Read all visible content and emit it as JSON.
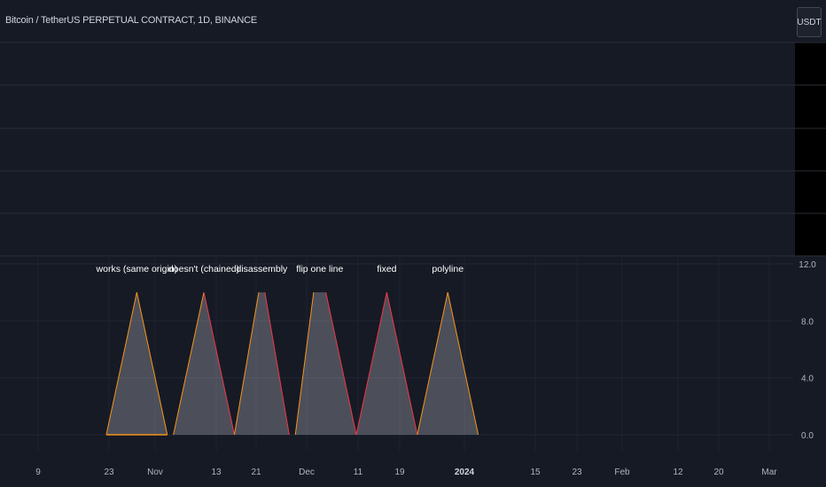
{
  "header": {
    "symbol_title": "Bitcoin / TetherUS PERPETUAL CONTRACT, 1D, BINANCE",
    "currency_button": "USDT"
  },
  "colors": {
    "background": "#161a25",
    "price_axis_background": "#000000",
    "grid": "#2a2e39",
    "line_orange": "#f7931a",
    "line_red": "#f23645",
    "fill": "rgba(178,181,190,0.35)"
  },
  "chart_data": {
    "type": "area",
    "title": "",
    "xlabel": "",
    "ylabel": "",
    "ylim": [
      0,
      12
    ],
    "y_ticks": [
      "12.0",
      "8.0",
      "4.0",
      "0.0"
    ],
    "x_ticks": [
      "9",
      "23",
      "Nov",
      "13",
      "21",
      "Dec",
      "11",
      "19",
      "2024",
      "15",
      "23",
      "Feb",
      "12",
      "20",
      "Mar"
    ],
    "grid": true,
    "shapes": [
      {
        "label": "works (same origin)",
        "points": [
          {
            "x": "2023-10-24",
            "y": 0
          },
          {
            "x": "2023-10-29",
            "y": 10
          },
          {
            "x": "2023-11-03",
            "y": 0
          }
        ],
        "base_line": "orange",
        "edges": [
          "orange",
          "orange"
        ]
      },
      {
        "label": "doesn't (chained)",
        "points": [
          {
            "x": "2023-11-04",
            "y": 0
          },
          {
            "x": "2023-11-09",
            "y": 10
          },
          {
            "x": "2023-11-14",
            "y": 0
          }
        ],
        "edges": [
          "orange",
          "red"
        ]
      },
      {
        "label": "disassembly",
        "points": [
          {
            "x": "2023-11-14",
            "y": 0
          },
          {
            "x": "2023-11-18",
            "y": 10
          },
          {
            "x": "2023-11-19",
            "y": 10
          },
          {
            "x": "2023-11-23",
            "y": 0
          }
        ],
        "edges": [
          "orange",
          "red"
        ]
      },
      {
        "label": "flip one line",
        "points": [
          {
            "x": "2023-11-24",
            "y": 0
          },
          {
            "x": "2023-11-27",
            "y": 10
          },
          {
            "x": "2023-11-29",
            "y": 10
          },
          {
            "x": "2023-12-04",
            "y": 0
          }
        ],
        "edges": [
          "orange",
          "red"
        ]
      },
      {
        "label": "fixed",
        "points": [
          {
            "x": "2023-12-04",
            "y": 0
          },
          {
            "x": "2023-12-09",
            "y": 10
          },
          {
            "x": "2023-12-14",
            "y": 0
          }
        ],
        "edges": [
          "red",
          "red"
        ]
      },
      {
        "label": "polyline",
        "points": [
          {
            "x": "2023-12-14",
            "y": 0
          },
          {
            "x": "2023-12-19",
            "y": 10
          },
          {
            "x": "2023-12-24",
            "y": 0
          }
        ],
        "edges": [
          "orange",
          "orange"
        ]
      }
    ]
  }
}
